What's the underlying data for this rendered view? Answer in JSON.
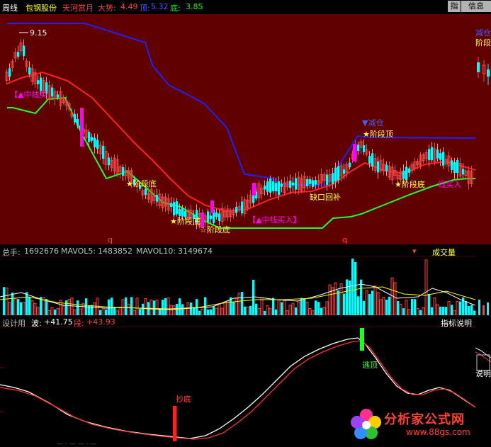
{
  "top_bar": {
    "period": "周线",
    "stock_name": "包钢股份",
    "indicator_name": "天河赏月",
    "trend_label": "大势:",
    "trend_value": "4.49",
    "top_label": "顶:",
    "top_value": "5.32",
    "bottom_label": "底:",
    "bottom_value": "3.85",
    "button_zhi": "指",
    "button_info": "信息"
  },
  "price_panel": {
    "high_marker": "9.15",
    "labels": {
      "mid_buy_top": "【▲中线买",
      "stage_bottom_1": "★阶段底",
      "stage_bottom_2": "★阶段底",
      "stage_bottom_3": "☆阶段底",
      "mid_buy": "【▲中线买入】",
      "gap_fill": "缺口回补",
      "reduce_pos": "▼减仓",
      "stage_top": "★阶段顶",
      "stage_bottom_4": "★阶段底",
      "mid_buy_right": "线买入",
      "q1": "q",
      "q2": "q"
    },
    "right_labels": {
      "reduce": "减仓",
      "stage": "阶段"
    }
  },
  "volume_header": {
    "total_label": "总手:",
    "total_value": "1692676",
    "mavol5_label": "MAVOL5:",
    "mavol5_value": "1483852",
    "mavol10_label": "MAVOL10:",
    "mavol10_value": "3149674",
    "panel_name": "成交量"
  },
  "osc_header": {
    "formula_label": "设计用",
    "wave_label": "波:",
    "wave_value": "+41.75",
    "segment_label": "段:",
    "segment_value": "+43.93",
    "explain_button": "指标说明"
  },
  "osc_panel": {
    "buy_bottom": "抄底",
    "escape_top": "逃顶",
    "right_explain": "说明"
  },
  "watermark": {
    "brand": "分析家公式网",
    "url": "www.88gs.com"
  },
  "colors": {
    "panel_bg": "#600000",
    "up_candle": "#ff4040",
    "down_candle": "#00ffff",
    "signal_magenta": "#ff00ff",
    "ma_red": "#ff2020",
    "support_green": "#20ff20",
    "resist_blue": "#2020ff"
  }
}
